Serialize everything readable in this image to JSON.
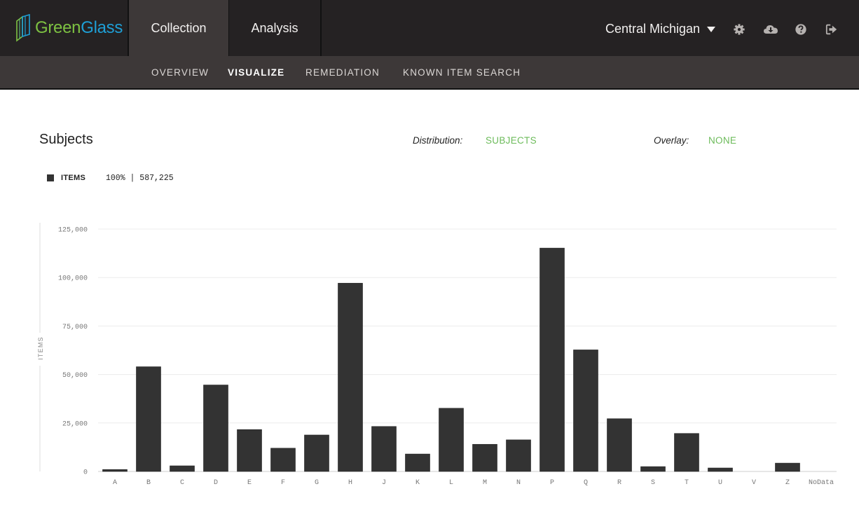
{
  "app": {
    "brand_part1": "Green",
    "brand_part2": "Glass",
    "brand_colors": {
      "green": "#7dc142",
      "blue": "#1e9fd6"
    }
  },
  "header": {
    "tabs": [
      {
        "label": "Collection",
        "active": true
      },
      {
        "label": "Analysis",
        "active": false
      }
    ],
    "org_selector": "Central Michigan",
    "icons": [
      "gear-icon",
      "cloud-download-icon",
      "help-icon",
      "sign-out-icon"
    ]
  },
  "subnav": {
    "items": [
      {
        "label": "OVERVIEW",
        "active": false
      },
      {
        "label": "VISUALIZE",
        "active": true
      },
      {
        "label": "REMEDIATION",
        "active": false
      },
      {
        "label": "KNOWN ITEM SEARCH",
        "active": false
      }
    ]
  },
  "page": {
    "title": "Subjects",
    "distribution_label": "Distribution:",
    "distribution_value": "SUBJECTS",
    "overlay_label": "Overlay:",
    "overlay_value": "NONE",
    "accent_color": "#6cbb5a"
  },
  "legend": {
    "label": "ITEMS",
    "value": "100% | 587,225"
  },
  "chart_data": {
    "type": "bar",
    "title": "Subjects",
    "xlabel": "",
    "ylabel": "ITEMS",
    "ylim": [
      0,
      125000
    ],
    "yticks": [
      0,
      25000,
      50000,
      75000,
      100000,
      125000
    ],
    "ytick_labels": [
      "0",
      "25,000",
      "50,000",
      "75,000",
      "100,000",
      "125,000"
    ],
    "grid": true,
    "bar_color": "#333333",
    "categories": [
      "A",
      "B",
      "C",
      "D",
      "E",
      "F",
      "G",
      "H",
      "J",
      "K",
      "L",
      "M",
      "N",
      "P",
      "Q",
      "R",
      "S",
      "T",
      "U",
      "V",
      "Z",
      "NoData"
    ],
    "series": [
      {
        "name": "ITEMS",
        "values": [
          1000,
          54000,
          2900,
          44600,
          21600,
          12000,
          18800,
          97100,
          23200,
          9000,
          32600,
          14000,
          16300,
          115200,
          62700,
          27200,
          2500,
          19600,
          1800,
          0,
          4300,
          0
        ]
      }
    ]
  }
}
